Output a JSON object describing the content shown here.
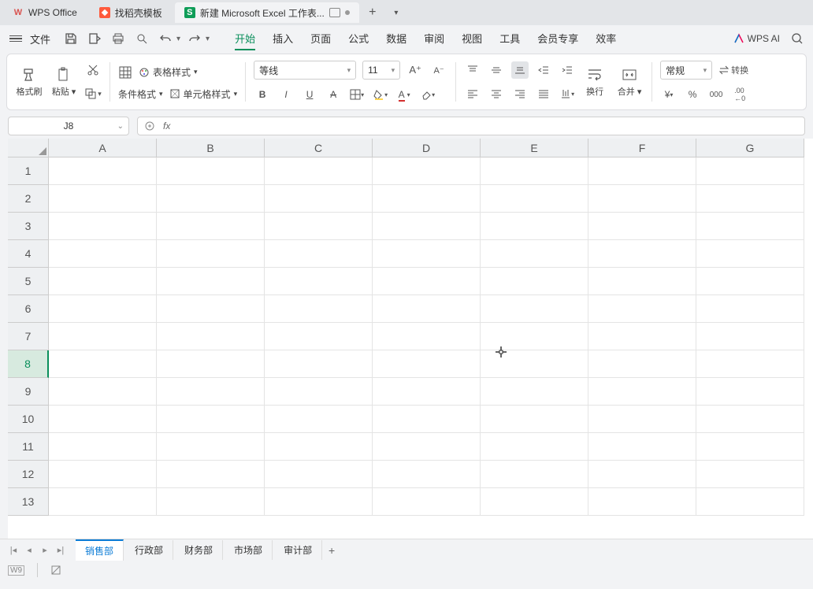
{
  "tabs": {
    "wps": "WPS Office",
    "docer": "找稻壳模板",
    "doc": "新建 Microsoft Excel 工作表..."
  },
  "menubar": {
    "file": "文件",
    "items": [
      "开始",
      "插入",
      "页面",
      "公式",
      "数据",
      "审阅",
      "视图",
      "工具",
      "会员专享",
      "效率"
    ],
    "active_index": 0,
    "wpsai": "WPS AI"
  },
  "ribbon": {
    "format_painter": "格式刷",
    "paste": "粘贴",
    "table_style": "表格样式",
    "cond_format": "条件格式",
    "cell_style": "单元格样式",
    "font_name": "等线",
    "font_size": "11",
    "wrap": "换行",
    "merge": "合并",
    "number_format": "常规",
    "convert": "转换"
  },
  "namebox": "J8",
  "columns": [
    "A",
    "B",
    "C",
    "D",
    "E",
    "F",
    "G"
  ],
  "rows": [
    "1",
    "2",
    "3",
    "4",
    "5",
    "6",
    "7",
    "8",
    "9",
    "10",
    "11",
    "12",
    "13"
  ],
  "selected_row_index": 7,
  "sheets": {
    "items": [
      "销售部",
      "行政部",
      "财务部",
      "市场部",
      "审计部"
    ],
    "active_index": 0
  }
}
